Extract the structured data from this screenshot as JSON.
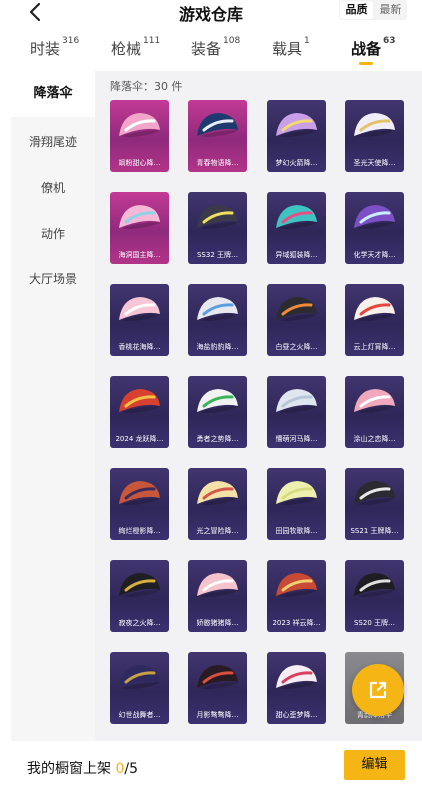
{
  "header": {
    "title": "游戏仓库",
    "sort_options": [
      "品质",
      "最新"
    ],
    "sort_selected": "品质"
  },
  "tabs": [
    {
      "label": "时装",
      "count": "316"
    },
    {
      "label": "枪械",
      "count": "111"
    },
    {
      "label": "装备",
      "count": "108"
    },
    {
      "label": "载具",
      "count": "1"
    },
    {
      "label": "战备",
      "count": "63",
      "active": true
    }
  ],
  "sidebar": {
    "items": [
      {
        "label": "降落伞",
        "active": true
      },
      {
        "label": "滑翔尾迹"
      },
      {
        "label": "僚机"
      },
      {
        "label": "动作"
      },
      {
        "label": "大厅场景"
      }
    ]
  },
  "content": {
    "count_label": "降落伞：30 件",
    "items": [
      {
        "label": "飒粉甜心降…",
        "bg": "pink",
        "c1": "#f2a5c8",
        "c2": "#ffffff"
      },
      {
        "label": "青春物语降…",
        "bg": "pink",
        "c1": "#1d3a6e",
        "c2": "#e8eef8"
      },
      {
        "label": "梦幻火箭降…",
        "bg": "purple",
        "c1": "#c9a0e8",
        "c2": "#f2d870"
      },
      {
        "label": "圣光天使降…",
        "bg": "purple",
        "c1": "#f0eef8",
        "c2": "#e6c267"
      },
      {
        "label": "海洞国主降…",
        "bg": "pink",
        "c1": "#f5b8d6",
        "c2": "#8fd3e8"
      },
      {
        "label": "SS32 王牌…",
        "bg": "purple",
        "c1": "#3a3a48",
        "c2": "#f0e060"
      },
      {
        "label": "异域狐装降…",
        "bg": "purple",
        "c1": "#3ec4c0",
        "c2": "#e84d8a"
      },
      {
        "label": "化学天才降…",
        "bg": "purple",
        "c1": "#7d4fc6",
        "c2": "#c8f0ff"
      },
      {
        "label": "香桃花海降…",
        "bg": "purple",
        "c1": "#f7c6d6",
        "c2": "#ffffff"
      },
      {
        "label": "海盐豹豹降…",
        "bg": "purple",
        "c1": "#e8e8ee",
        "c2": "#5aa0e0"
      },
      {
        "label": "白昼之火降…",
        "bg": "purple",
        "c1": "#2b2b30",
        "c2": "#f08a3c"
      },
      {
        "label": "云上灯宵降…",
        "bg": "purple",
        "c1": "#f8f0ea",
        "c2": "#e2483c"
      },
      {
        "label": "2024 龙跃降…",
        "bg": "purple",
        "c1": "#d8412f",
        "c2": "#f2c347"
      },
      {
        "label": "勇者之势降…",
        "bg": "purple",
        "c1": "#f2f2f2",
        "c2": "#3ab45a"
      },
      {
        "label": "懵萌河马降…",
        "bg": "purple",
        "c1": "#e0e6ee",
        "c2": "#b5c8d8"
      },
      {
        "label": "涂山之恋降…",
        "bg": "purple",
        "c1": "#f0a8bc",
        "c2": "#ffffff"
      },
      {
        "label": "绚烂橙影降…",
        "bg": "purple",
        "c1": "#c8563a",
        "c2": "#3a2c5a"
      },
      {
        "label": "光之冒险降…",
        "bg": "purple",
        "c1": "#f4e2a8",
        "c2": "#d25a4a"
      },
      {
        "label": "田园牧歌降…",
        "bg": "purple",
        "c1": "#eef0b0",
        "c2": "#d8dc80"
      },
      {
        "label": "SS21 王牌降…",
        "bg": "purple",
        "c1": "#2a2a30",
        "c2": "#e8e8e8"
      },
      {
        "label": "寂夜之火降…",
        "bg": "purple",
        "c1": "#1e1e24",
        "c2": "#d8b040"
      },
      {
        "label": "娇憨猪猪降…",
        "bg": "purple",
        "c1": "#f6c2cc",
        "c2": "#ffffff"
      },
      {
        "label": "2023 祥云降…",
        "bg": "purple",
        "c1": "#c84a34",
        "c2": "#f0d070"
      },
      {
        "label": "SS20 王牌…",
        "bg": "purple",
        "c1": "#1e1e22",
        "c2": "#e0e0e0"
      },
      {
        "label": "幻世战舞者…",
        "bg": "purple",
        "c1": "#2e2a60",
        "c2": "#c8a048"
      },
      {
        "label": "月影骜骜降…",
        "bg": "purple",
        "c1": "#2a1a24",
        "c2": "#d85040"
      },
      {
        "label": "甜心歪梦降…",
        "bg": "purple",
        "c1": "#f6eef2",
        "c2": "#d84060"
      },
      {
        "label": "青韵降落伞",
        "bg": "gray",
        "c1": "#9aa0a8",
        "c2": "#ffffff"
      }
    ]
  },
  "fab": {
    "icon": "share-icon"
  },
  "footer": {
    "shelf_label": "我的橱窗上架",
    "shelf_current": "0",
    "shelf_total": "/5",
    "edit_label": "编辑"
  },
  "colors": {
    "accent": "#f5b514",
    "tile_purple": "#362d64",
    "tile_pink": "#b03287"
  }
}
